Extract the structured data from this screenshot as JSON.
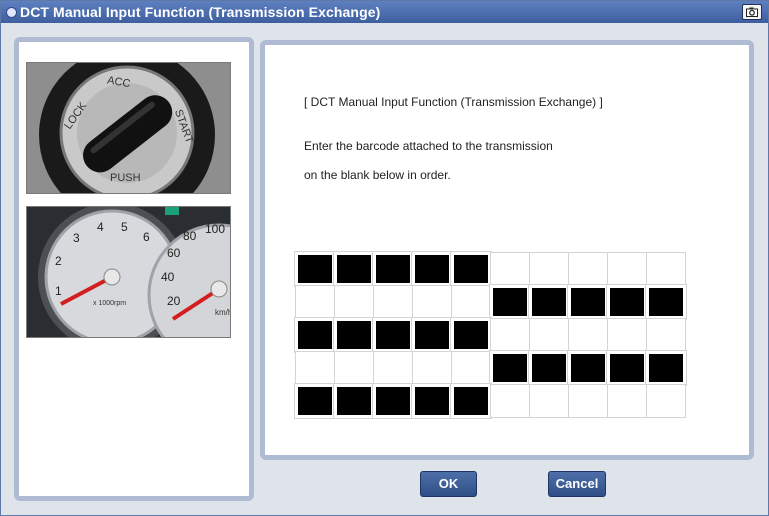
{
  "window": {
    "title": "DCT Manual Input Function (Transmission Exchange)",
    "title_icon": "window-menu-icon",
    "capture_icon": "camera-icon"
  },
  "images": {
    "ignition": {
      "alt": "ignition switch",
      "labels": [
        "LOCK",
        "ACC",
        "START",
        "PUSH"
      ]
    },
    "gauge": {
      "alt": "instrument cluster tachometer and speedometer",
      "tach_labels": [
        "1",
        "2",
        "3",
        "4",
        "5",
        "6"
      ],
      "tach_unit": "x 1000rpm",
      "speed_labels": [
        "20",
        "40",
        "60",
        "80",
        "100"
      ],
      "speed_unit": "km/h"
    }
  },
  "content": {
    "heading": "[ DCT Manual Input Function (Transmission Exchange) ]",
    "instruction_line1": "Enter the barcode attached to the transmission",
    "instruction_line2": "on the blank below in order."
  },
  "barcode_grid": {
    "columns": 10,
    "rows": [
      [
        1,
        1,
        1,
        1,
        1,
        0,
        0,
        0,
        0,
        0
      ],
      [
        0,
        0,
        0,
        0,
        0,
        1,
        1,
        1,
        1,
        1
      ],
      [
        1,
        1,
        1,
        1,
        1,
        0,
        0,
        0,
        0,
        0
      ],
      [
        0,
        0,
        0,
        0,
        0,
        1,
        1,
        1,
        1,
        1
      ],
      [
        1,
        1,
        1,
        1,
        1,
        0,
        0,
        0,
        0,
        0
      ]
    ],
    "filled_color": "#000000",
    "empty_color": "#ffffff"
  },
  "buttons": {
    "ok_label": "OK",
    "cancel_label": "Cancel"
  },
  "colors": {
    "title_bar": "#4a6cae",
    "button": "#3f5f98",
    "panel_border": "#aebbd2"
  }
}
